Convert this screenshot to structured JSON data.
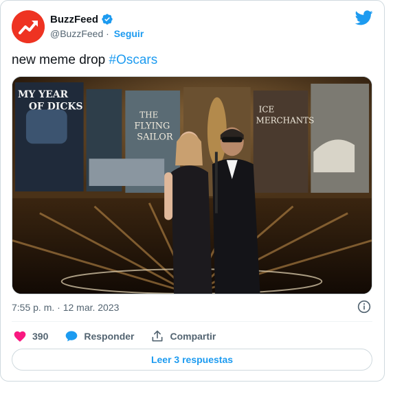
{
  "account": {
    "display_name": "BuzzFeed",
    "handle": "@BuzzFeed",
    "separator": " · ",
    "follow_label": "Seguir",
    "brand_color": "#ee3322",
    "verified_color": "#1d9bf0"
  },
  "tweet": {
    "text": "new meme drop ",
    "hashtag": "#Oscars",
    "timestamp": "7:55 p. m. · 12 mar. 2023"
  },
  "media": {
    "screen_texts": [
      "MY YEAR OF DICKS",
      "THE FLYING SAILOR",
      "ICE MERCHANTS"
    ]
  },
  "actions": {
    "like_count": "390",
    "reply_label": "Responder",
    "share_label": "Compartir"
  },
  "footer": {
    "read_replies_label": "Leer 3 respuestas"
  },
  "icons": {
    "avatar": "buzzfeed-trend-arrow-icon",
    "verified": "verified-badge-icon",
    "platform": "twitter-bird-icon",
    "info": "info-icon",
    "like": "heart-icon",
    "reply": "speech-bubble-icon",
    "share": "share-upload-icon"
  },
  "colors": {
    "link": "#1d9bf0",
    "like": "#f91880",
    "secondary_text": "#536471"
  }
}
